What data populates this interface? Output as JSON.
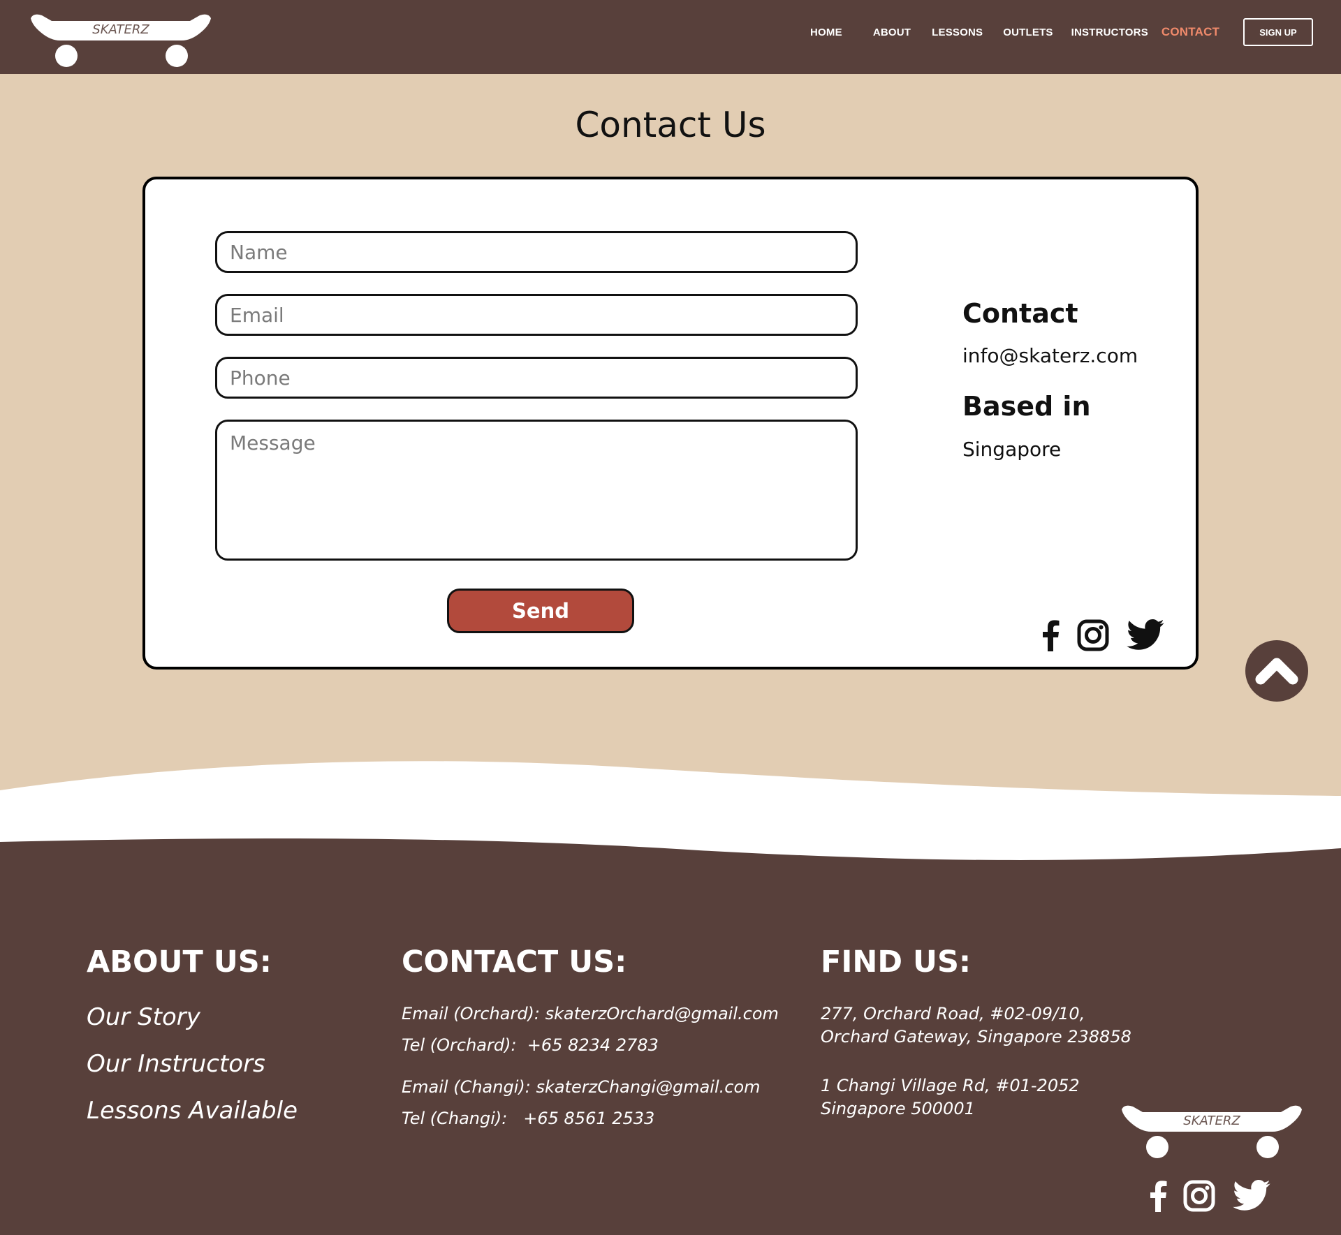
{
  "brand": {
    "name": "SKATERZ"
  },
  "nav": {
    "items": [
      {
        "label": "HOME"
      },
      {
        "label": "ABOUT"
      },
      {
        "label": "LESSONS"
      },
      {
        "label": "OUTLETS"
      },
      {
        "label": "INSTRUCTORS"
      },
      {
        "label": "CONTACT",
        "active": true
      }
    ],
    "signup_label": "SIGN UP"
  },
  "page": {
    "title": "Contact Us"
  },
  "form": {
    "name_placeholder": "Name",
    "email_placeholder": "Email",
    "phone_placeholder": "Phone",
    "message_placeholder": "Message",
    "send_label": "Send"
  },
  "info": {
    "contact_heading": "Contact",
    "contact_email": "info@skaterz.com",
    "based_heading": "Based in",
    "based_value": "Singapore"
  },
  "social": [
    "facebook-icon",
    "instagram-icon",
    "twitter-icon"
  ],
  "footer": {
    "about": {
      "heading": "ABOUT US:",
      "links": [
        "Our Story",
        "Our Instructors",
        "Lessons Available"
      ]
    },
    "contact": {
      "heading": "CONTACT US:",
      "lines": [
        "Email (Orchard): skaterzOrchard@gmail.com",
        "Tel (Orchard):  +65 8234 2783",
        "Email (Changi): skaterzChangi@gmail.com",
        "Tel (Changi):   +65 8561 2533"
      ]
    },
    "find": {
      "heading": "FIND US:",
      "lines": [
        "277, Orchard Road, #02-09/10,",
        "Orchard Gateway, Singapore 238858",
        "1 Changi Village Rd, #01-2052",
        "Singapore 500001"
      ]
    }
  },
  "colors": {
    "header_bg": "#58403b",
    "page_bg": "#e2cdb3",
    "accent_nav": "#f08a6b",
    "send_button": "#b24a3c"
  }
}
